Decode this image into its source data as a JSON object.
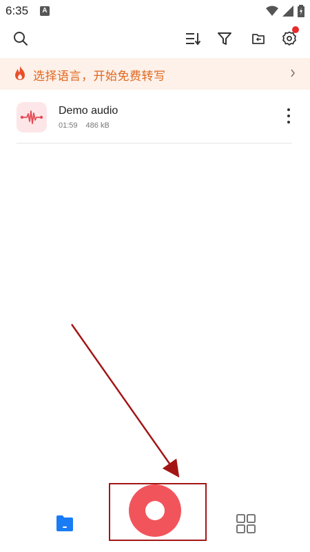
{
  "status_bar": {
    "time": "6:35",
    "notification_letter": "A"
  },
  "toolbar": {
    "search_icon": "search-icon",
    "sort_icon": "sort-icon",
    "filter_icon": "filter-icon",
    "folder_icon": "folder-import-icon",
    "settings_icon": "gear-icon"
  },
  "banner": {
    "text": "选择语言，开始免费转写"
  },
  "recordings": [
    {
      "title": "Demo audio",
      "duration": "01:59",
      "size": "486 kB"
    }
  ],
  "colors": {
    "accent_red": "#f2545b",
    "banner_bg": "#fdf1ea",
    "banner_text": "#e0671f",
    "files_blue": "#1a7cf5",
    "annotation": "#a31515"
  }
}
